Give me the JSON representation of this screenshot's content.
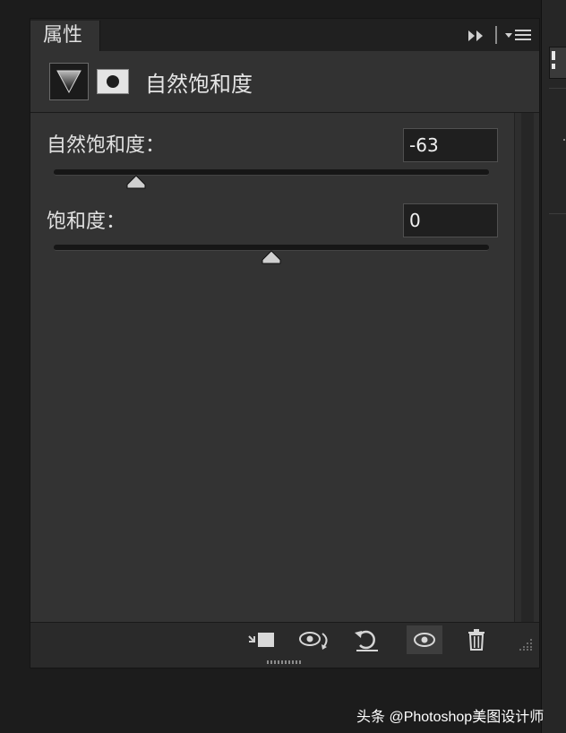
{
  "panel": {
    "tab_label": "属性",
    "title": "自然饱和度"
  },
  "controls": [
    {
      "label": "自然饱和度：",
      "value": "-63",
      "slider_fraction": 0.19
    },
    {
      "label": "饱和度：",
      "value": "0",
      "slider_fraction": 0.5
    }
  ],
  "icons": {
    "collapse": "double-arrow-right-icon",
    "menu": "panel-menu-icon",
    "adjustment": "vibrance-triangle-icon",
    "mask": "layer-mask-icon",
    "clip": "clip-to-layer-icon",
    "view_previous": "view-previous-state-icon",
    "reset": "reset-icon",
    "visibility": "eye-icon",
    "delete": "trash-icon"
  },
  "watermark": "头条 @Photoshop美图设计师"
}
